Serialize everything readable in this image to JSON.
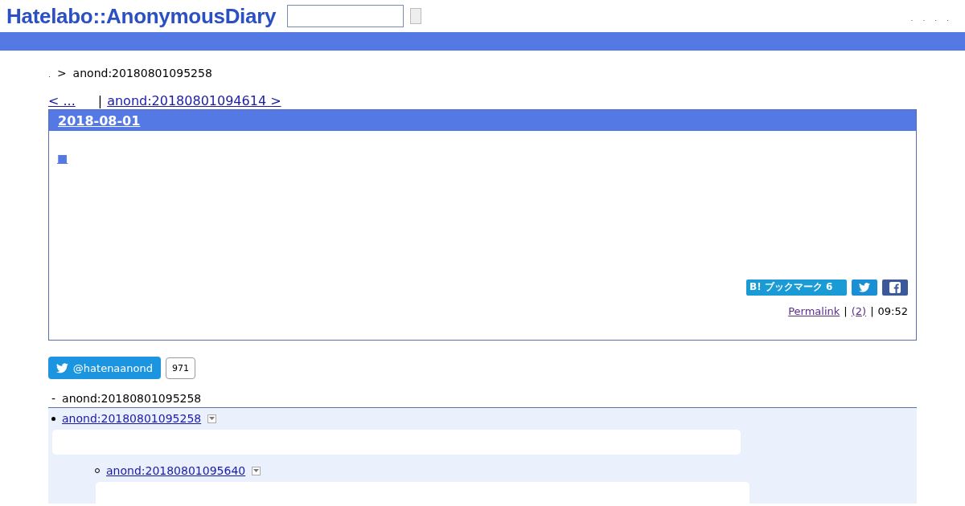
{
  "header": {
    "logo": "Hatelabo::AnonymousDiary",
    "nav_links": [
      ".",
      ".",
      ".",
      "."
    ]
  },
  "breadcrumb": {
    "home": ".",
    "separator": ">",
    "current": "anond:20180801095258"
  },
  "pager": {
    "prev": "< ...",
    "separator": "|",
    "next": "anond:20180801094614 >"
  },
  "entry": {
    "date": "2018-08-01",
    "title_mark": "■",
    "bookmark": {
      "label": "B! ブックマーク",
      "count": "6"
    },
    "footer": {
      "permalink": "Permalink",
      "separator_1": "|",
      "comments": "(2)",
      "separator_2": "|",
      "time": "09:52"
    }
  },
  "follow": {
    "handle": "@hatenaanond",
    "count": "971"
  },
  "references": {
    "marker": "-",
    "title": "anond:20180801095258",
    "tree": [
      {
        "label": "anond:20180801095258",
        "children": [
          {
            "label": "anond:20180801095640"
          }
        ]
      }
    ]
  }
}
